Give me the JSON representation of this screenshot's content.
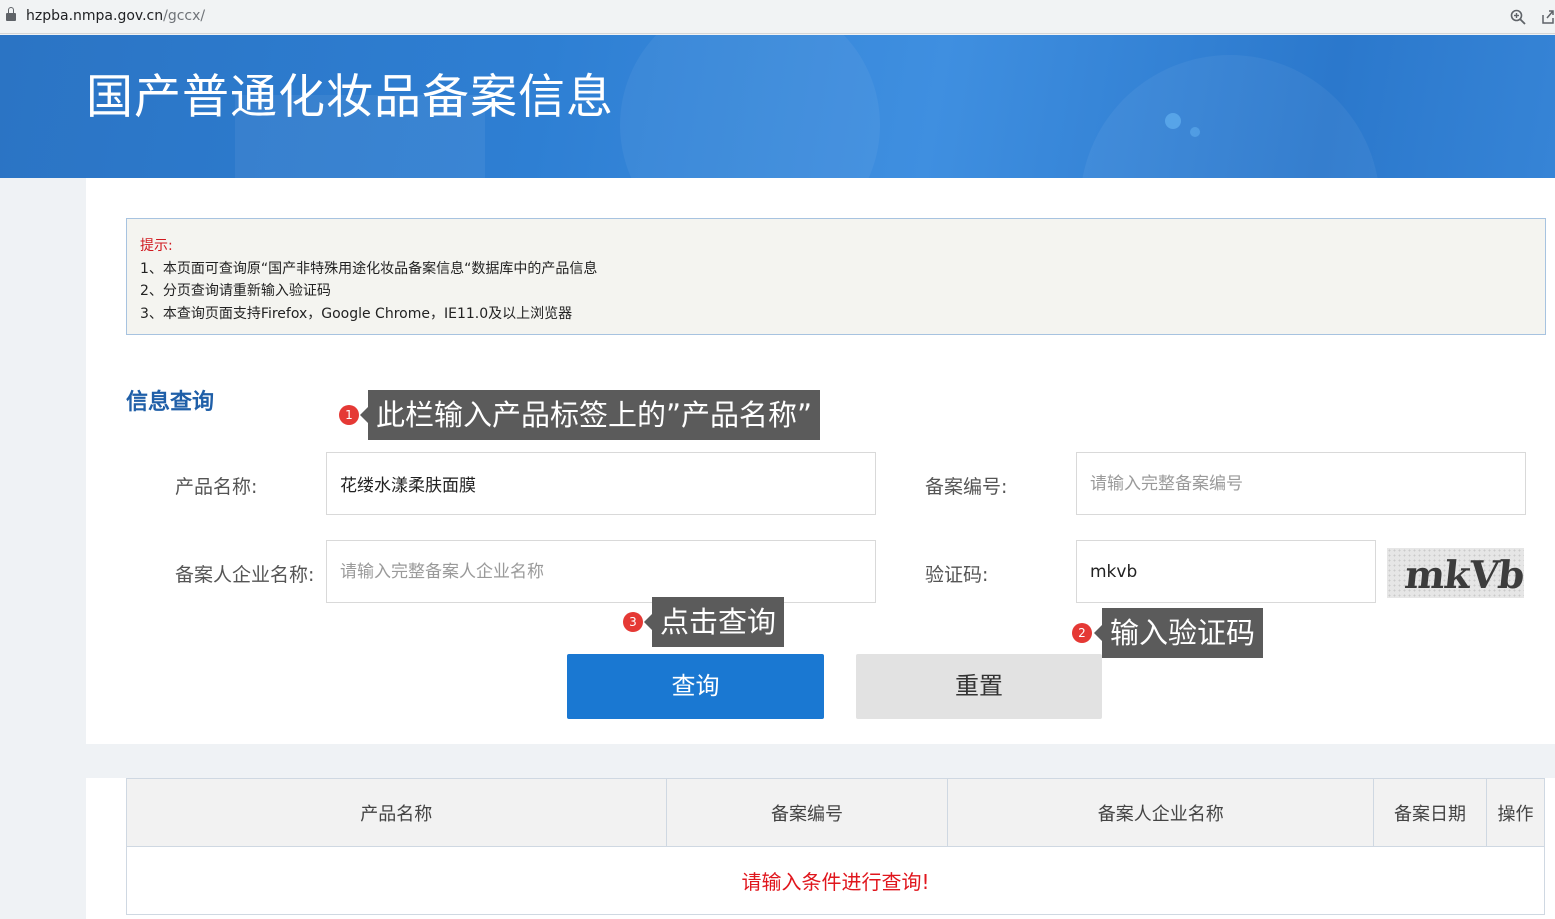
{
  "browser": {
    "url_host": "hzpba.nmpa.gov.cn",
    "url_path": "/gccx/"
  },
  "banner": {
    "title": "国产普通化妆品备案信息"
  },
  "notice": {
    "tip_label": "提示:",
    "lines": [
      "1、本页面可查询原“国产非特殊用途化妆品备案信息“数据库中的产品信息",
      "2、分页查询请重新输入验证码",
      "3、本查询页面支持Firefox，Google Chrome，IE11.0及以上浏览器"
    ]
  },
  "form": {
    "section_title": "信息查询",
    "product_name": {
      "label": "产品名称:",
      "value": "花缕水漾柔肤面膜",
      "placeholder": ""
    },
    "record_number": {
      "label": "备案编号:",
      "value": "",
      "placeholder": "请输入完整备案编号"
    },
    "company_name": {
      "label": "备案人企业名称:",
      "value": "",
      "placeholder": "请输入完整备案人企业名称"
    },
    "captcha": {
      "label": "验证码:",
      "value": "mkvb",
      "image_text": "mkVb"
    },
    "query_button": "查询",
    "reset_button": "重置"
  },
  "annotations": [
    {
      "badge": "1",
      "text": "此栏输入产品标签上的”产品名称”"
    },
    {
      "badge": "2",
      "text": "输入验证码"
    },
    {
      "badge": "3",
      "text": "点击查询"
    }
  ],
  "results_table": {
    "columns": [
      "产品名称",
      "备案编号",
      "备案人企业名称",
      "备案日期",
      "操作"
    ],
    "empty_message": "请输入条件进行查询!"
  },
  "colors": {
    "banner": "#2e7fd3",
    "primary_button": "#1a78d2",
    "section_title": "#1f5fa8",
    "alert_text": "#e0161d",
    "callout_bg": "#5b5b5b",
    "badge": "#e53935"
  }
}
